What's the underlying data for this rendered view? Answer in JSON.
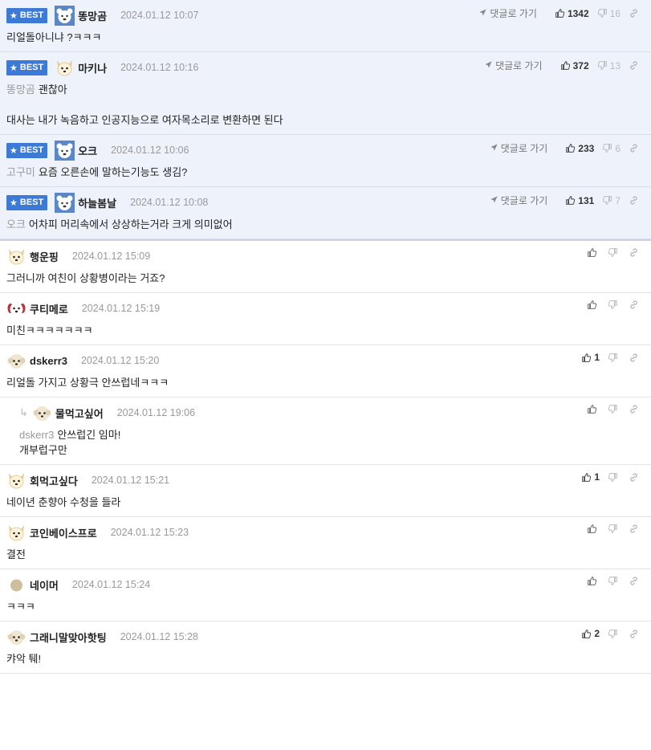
{
  "labels": {
    "best": "BEST",
    "goto": "댓글로 가기"
  },
  "best_comments": [
    {
      "nick": "똥망곰",
      "date": "2024.01.12 10:07",
      "avatar": "bear-avatar",
      "likes": "1342",
      "dislikes": "16",
      "mention": "",
      "lines": [
        "리얼돌아니냐 ?ㅋㅋㅋ"
      ]
    },
    {
      "nick": "마키나",
      "date": "2024.01.12 10:16",
      "avatar": "dog-avatar",
      "likes": "372",
      "dislikes": "13",
      "mention": "똥망곰",
      "lines": [
        "괜찮아",
        "",
        "대사는 내가 녹음하고 인공지능으로 여자목소리로 변환하면 된다"
      ]
    },
    {
      "nick": "오크",
      "date": "2024.01.12 10:06",
      "avatar": "bear-avatar",
      "likes": "233",
      "dislikes": "6",
      "mention": "고구미",
      "lines": [
        "요즘 오른손에 말하는기능도 생김?"
      ]
    },
    {
      "nick": "하늘봄날",
      "date": "2024.01.12 10:08",
      "avatar": "bear-avatar",
      "likes": "131",
      "dislikes": "7",
      "mention": "오크",
      "lines": [
        "어차피 머리속에서 상상하는거라 크게 의미없어"
      ]
    }
  ],
  "comments": [
    {
      "nick": "행운핑",
      "date": "2024.01.12 15:09",
      "avatar": "dog-avatar",
      "likes": "",
      "mention": "",
      "reply": false,
      "lines": [
        "그러니까 여친이 상황병이라는 거죠?"
      ]
    },
    {
      "nick": "쿠티메로",
      "date": "2024.01.12 15:19",
      "avatar": "puppy-avatar",
      "likes": "",
      "mention": "",
      "reply": false,
      "lines": [
        "미친ㅋㅋㅋㅋㅋㅋㅋ"
      ]
    },
    {
      "nick": "dskerr3",
      "date": "2024.01.12 15:20",
      "avatar": "fluffy-avatar",
      "likes": "1",
      "mention": "",
      "reply": false,
      "lines": [
        "리얼돌 가지고 상황극 안쓰럽네ㅋㅋㅋ"
      ]
    },
    {
      "nick": "물먹고싶어",
      "date": "2024.01.12 19:06",
      "avatar": "fluffy-avatar",
      "likes": "",
      "mention": "dskerr3",
      "reply": true,
      "lines": [
        "안쓰럽긴 임마!",
        "개부럽구만"
      ]
    },
    {
      "nick": "회먹고싶다",
      "date": "2024.01.12 15:21",
      "avatar": "dog-avatar",
      "likes": "1",
      "mention": "",
      "reply": false,
      "lines": [
        "네이년 춘향아 수청을 들라"
      ]
    },
    {
      "nick": "코인베이스프로",
      "date": "2024.01.12 15:23",
      "avatar": "dog-avatar",
      "likes": "",
      "mention": "",
      "reply": false,
      "lines": [
        "결전"
      ]
    },
    {
      "nick": "네이머",
      "date": "2024.01.12 15:24",
      "avatar": "circle-avatar",
      "likes": "",
      "mention": "",
      "reply": false,
      "lines": [
        "ㅋㅋㅋ"
      ]
    },
    {
      "nick": "그래니말맞아핫팅",
      "date": "2024.01.12 15:28",
      "avatar": "fluffy-avatar",
      "likes": "2",
      "mention": "",
      "reply": false,
      "lines": [
        "캬악 퉤!"
      ]
    }
  ]
}
